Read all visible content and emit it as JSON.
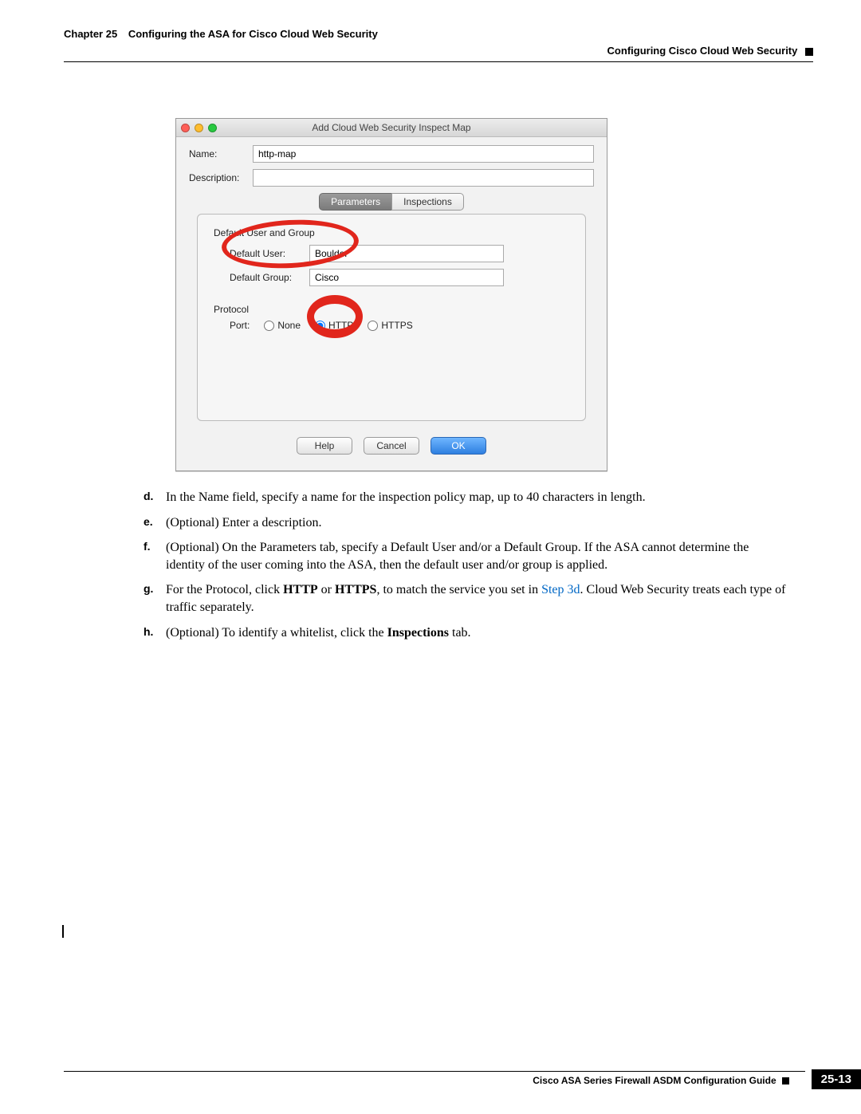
{
  "header": {
    "chapter_num": "Chapter 25",
    "chapter_title": "Configuring the ASA for Cisco Cloud Web Security",
    "section_title": "Configuring Cisco Cloud Web Security"
  },
  "dialog": {
    "title": "Add Cloud Web Security Inspect Map",
    "name_label": "Name:",
    "name_value": "http-map",
    "desc_label": "Description:",
    "desc_value": "",
    "tabs": {
      "parameters": "Parameters",
      "inspections": "Inspections"
    },
    "group": {
      "heading": "Default User and Group",
      "user_label": "Default User:",
      "user_value": "Boulder",
      "group_label": "Default Group:",
      "group_value": "Cisco"
    },
    "protocol": {
      "heading": "Protocol",
      "port_label": "Port:",
      "options": {
        "none": "None",
        "http": "HTTP",
        "https": "HTTPS"
      },
      "selected": "http"
    },
    "buttons": {
      "help": "Help",
      "cancel": "Cancel",
      "ok": "OK"
    }
  },
  "steps": {
    "d": "In the Name field, specify a name for the inspection policy map, up to 40 characters in length.",
    "e": "(Optional) Enter a description.",
    "f": "(Optional) On the Parameters tab, specify a Default User and/or a Default Group. If the ASA cannot determine the identity of the user coming into the ASA, then the default user and/or group is applied.",
    "g_pre": "For the Protocol, click ",
    "g_http": "HTTP",
    "g_or": " or ",
    "g_https": "HTTPS",
    "g_mid": ", to match the service you set in ",
    "g_link": "Step 3d",
    "g_post": ". Cloud Web Security treats each type of traffic separately.",
    "h_pre": "(Optional) To identify a whitelist, click the ",
    "h_bold": "Inspections",
    "h_post": " tab."
  },
  "footer": {
    "guide": "Cisco ASA Series Firewall ASDM Configuration Guide",
    "page": "25-13"
  }
}
